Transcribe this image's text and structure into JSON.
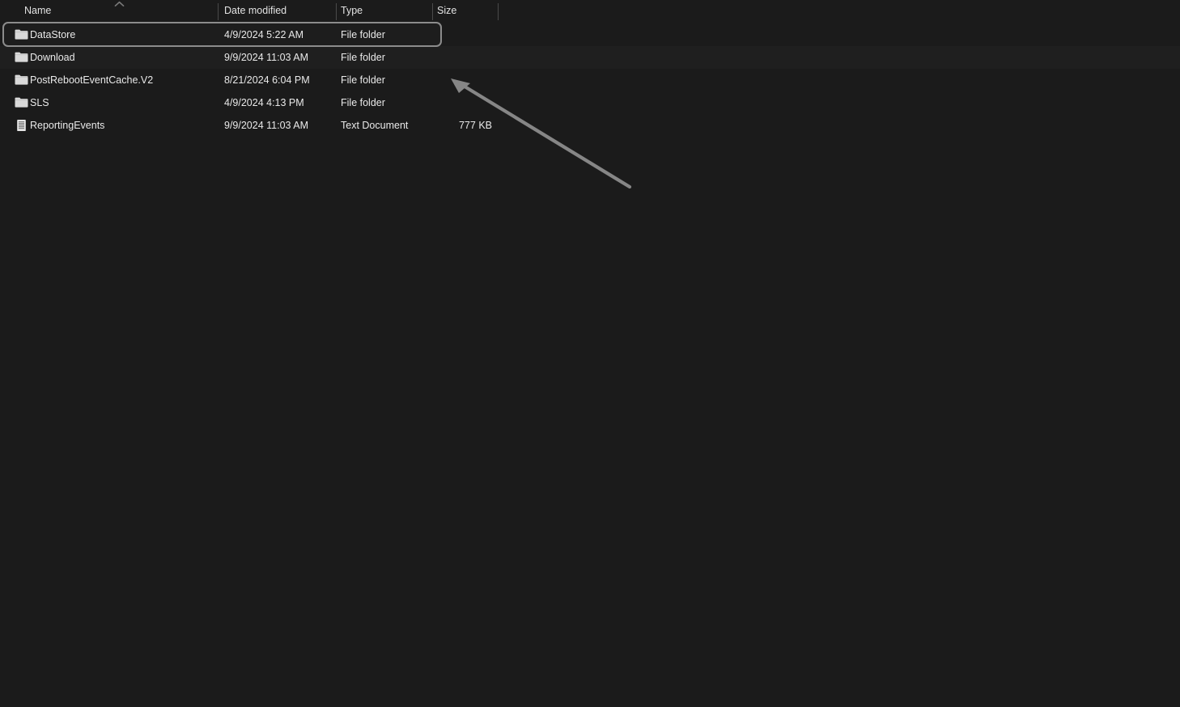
{
  "columns": {
    "name": "Name",
    "date_modified": "Date modified",
    "type": "Type",
    "size": "Size",
    "sort_column": "Name",
    "sort_direction": "ascending",
    "sort_icon": "chevron-up-icon"
  },
  "rows": [
    {
      "name": "DataStore",
      "date_modified": "4/9/2024 5:22 AM",
      "type": "File folder",
      "size": "",
      "icon": "folder-icon",
      "selected": false
    },
    {
      "name": "Download",
      "date_modified": "9/9/2024 11:03 AM",
      "type": "File folder",
      "size": "",
      "icon": "folder-icon",
      "selected": true
    },
    {
      "name": "PostRebootEventCache.V2",
      "date_modified": "8/21/2024 6:04 PM",
      "type": "File folder",
      "size": "",
      "icon": "folder-icon",
      "selected": false
    },
    {
      "name": "SLS",
      "date_modified": "4/9/2024 4:13 PM",
      "type": "File folder",
      "size": "",
      "icon": "folder-icon",
      "selected": false
    },
    {
      "name": "ReportingEvents",
      "date_modified": "9/9/2024 11:03 AM",
      "type": "Text Document",
      "size": "777 KB",
      "icon": "text-document-icon",
      "selected": false
    }
  ],
  "annotation": {
    "arrow_icon": "arrow-pointing-up-left-icon",
    "color": "#868686"
  },
  "colors": {
    "background": "#1b1b1b",
    "text": "#e9e9e9",
    "divider": "#4a4a4a",
    "selection_outline": "#8c8c8c",
    "folder_icon": "#dcdcdc",
    "annotation": "#868686"
  }
}
